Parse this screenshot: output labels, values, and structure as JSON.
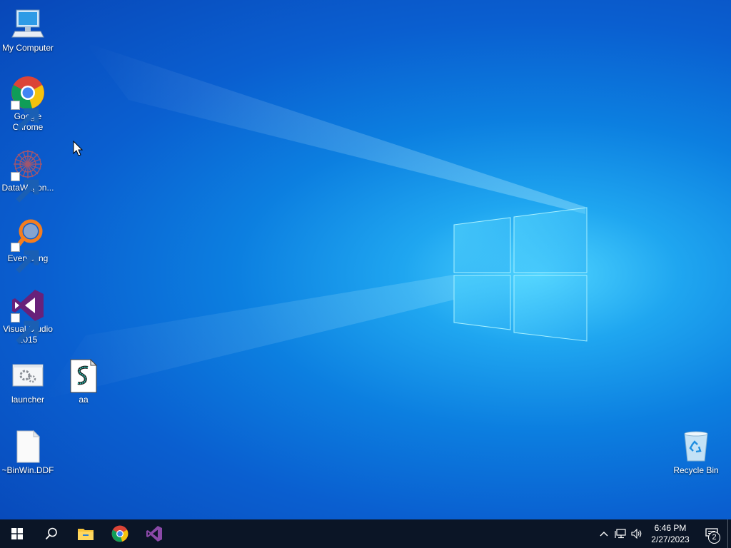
{
  "desktop": {
    "icons": [
      {
        "label": "My Computer",
        "icon": "computer-icon",
        "shortcut": false
      },
      {
        "label": "Google Chrome",
        "icon": "chrome-icon",
        "shortcut": true
      },
      {
        "label": "DataWagon...",
        "icon": "datawagon-icon",
        "shortcut": true
      },
      {
        "label": "Everything",
        "icon": "everything-search-icon",
        "shortcut": true
      },
      {
        "label": "Visual Studio 2015",
        "icon": "visual-studio-icon",
        "shortcut": true
      },
      {
        "label": "launcher",
        "icon": "launcher-window-icon",
        "shortcut": false
      },
      {
        "label": "aa",
        "icon": "script-file-icon",
        "shortcut": false
      },
      {
        "label": "~BinWin.DDF",
        "icon": "blank-file-icon",
        "shortcut": false
      },
      {
        "label": "Recycle Bin",
        "icon": "recycle-bin-icon",
        "shortcut": false
      }
    ]
  },
  "taskbar": {
    "pinned": [
      "start-icon",
      "search-icon",
      "file-explorer-icon",
      "chrome-icon",
      "visual-studio-icon"
    ],
    "tray": {
      "icons": [
        "chevron-up-icon",
        "network-icon",
        "volume-icon"
      ],
      "time": "6:46 PM",
      "date": "2/27/2023",
      "notification_count": "2"
    }
  },
  "colors": {
    "wallpaper_core": "#4fd4ff",
    "wallpaper_edge": "#0847b8",
    "taskbar": "#0b1526",
    "vs_purple": "#68217a",
    "everything_orange": "#f47d1f"
  }
}
